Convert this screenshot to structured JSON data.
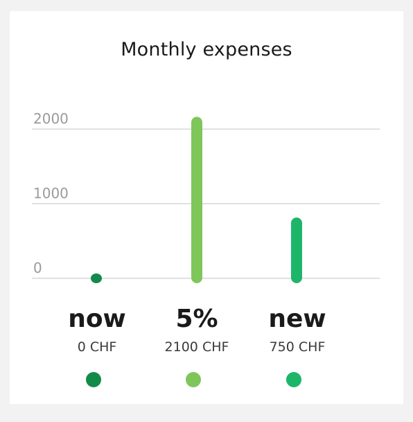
{
  "title": "Monthly expenses",
  "colors": {
    "now": "#148a4a",
    "pct5": "#7fc65a",
    "new": "#1db56a"
  },
  "chart_data": {
    "type": "bar",
    "title": "Monthly expenses",
    "xlabel": "",
    "ylabel": "",
    "ylim": [
      0,
      2000
    ],
    "yticks": [
      "0",
      "1000",
      "2000"
    ],
    "grid": true,
    "categories": [
      "now",
      "5%",
      "new"
    ],
    "values": [
      0,
      2100,
      750
    ],
    "labels": [
      "0 CHF",
      "2100 CHF",
      "750 CHF"
    ]
  }
}
